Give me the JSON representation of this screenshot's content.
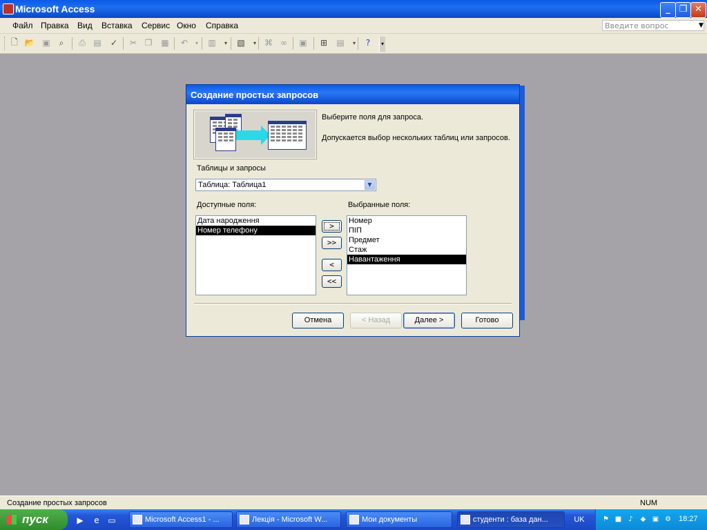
{
  "window": {
    "title": "Microsoft Access",
    "min_glyph": "_",
    "max_glyph": "❐",
    "close_glyph": "✕"
  },
  "menu": {
    "items": [
      "Файл",
      "Правка",
      "Вид",
      "Вставка",
      "Сервис",
      "Окно",
      "Справка"
    ],
    "ask_placeholder": "Введите вопрос"
  },
  "toolbar": {
    "icons": [
      "new-icon",
      "open-icon",
      "save-icon",
      "search-icon",
      "print-icon",
      "preview-icon",
      "spell-icon",
      "cut-icon",
      "copy-icon",
      "paste-icon",
      "undo-icon",
      "office-links-icon",
      "analyze-icon",
      "code-icon",
      "script-icon",
      "properties-icon",
      "relationships-icon",
      "new-object-icon",
      "help-icon"
    ]
  },
  "dialog": {
    "title": "Создание  простых запросов",
    "instruction": "Выберите поля для запроса.",
    "note": "Допускается выбор нескольких таблиц или запросов.",
    "tables_label": "Таблицы и запросы",
    "table_selected": "Таблица: Таблица1",
    "available_label": "Доступные поля:",
    "available_fields": [
      "Дата народження",
      "Номер телефону"
    ],
    "available_selected_index": 1,
    "selected_label": "Выбранные поля:",
    "selected_fields": [
      "Номер",
      "ПІП",
      "Предмет",
      "Стаж",
      "Навантаження"
    ],
    "selected_selected_index": 4,
    "move_buttons": {
      "add_one": ">",
      "add_all": ">>",
      "remove_one": "<",
      "remove_all": "<<"
    },
    "buttons": {
      "cancel": "Отмена",
      "back": "< Назад",
      "next": "Далее >",
      "finish": "Готово"
    }
  },
  "statusbar": {
    "text": "Создание простых запросов",
    "num": "NUM"
  },
  "taskbar": {
    "start": "пуск",
    "tasks": [
      {
        "label": "Microsoft Access1 - ...",
        "active": false
      },
      {
        "label": "Лекція - Microsoft W...",
        "active": false
      },
      {
        "label": "Мои документы",
        "active": false
      },
      {
        "label": "студенти : база дан...",
        "active": true
      }
    ],
    "lang": "UK",
    "clock": "18:27"
  },
  "colors": {
    "titlebar": "#0a5ae6",
    "workspace": "#a5a3a8",
    "selection": "#000000",
    "tray": "#12a6f0"
  }
}
